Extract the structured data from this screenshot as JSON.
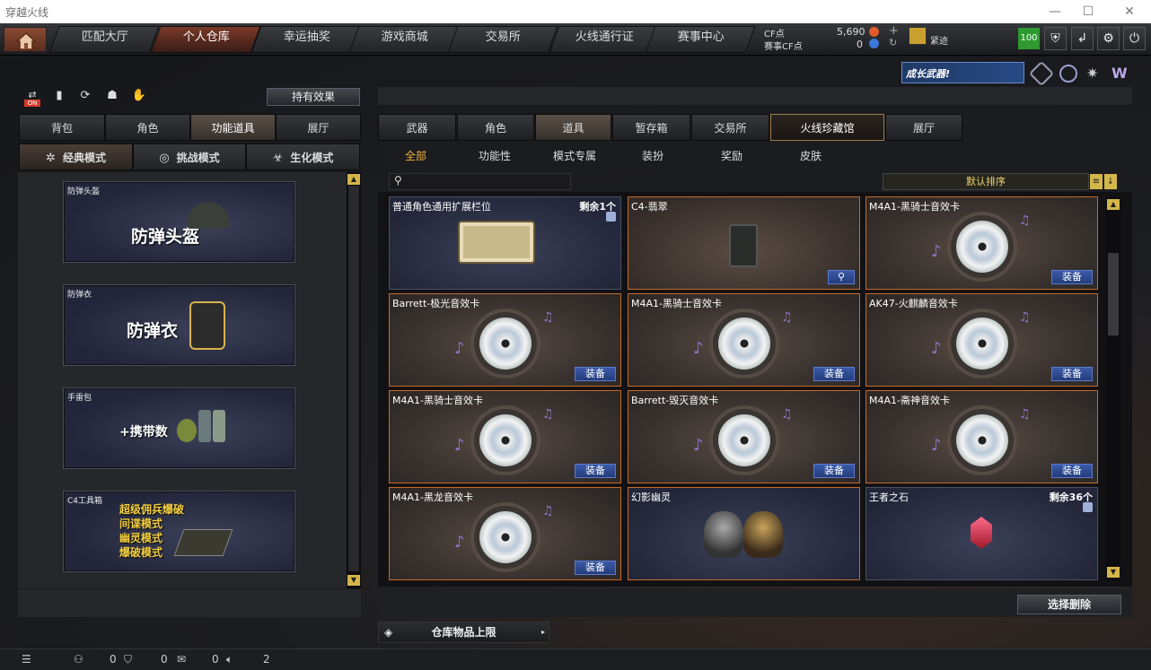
{
  "window": {
    "title": "穿越火线",
    "min": "—",
    "max": "☐",
    "close": "✕"
  },
  "nav": {
    "tabs": [
      "匹配大厅",
      "个人仓库",
      "幸运抽奖",
      "游戏商城",
      "交易所",
      "火线通行证",
      "赛事中心"
    ],
    "active_index": 1
  },
  "currency": {
    "cf_label": "CF点",
    "cf_value": "5,690",
    "match_label": "赛事CF点",
    "match_value": "0",
    "plus": "+",
    "refresh": "↻",
    "rank_name": "紧迹",
    "badge": "100",
    "brand_color": "#c66a2a"
  },
  "promo": {
    "banner": "成长武器!"
  },
  "left": {
    "on_label": "ON",
    "effect_button": "持有效果",
    "tabs": [
      "背包",
      "角色",
      "功能道具",
      "展厅"
    ],
    "active_tab": 2,
    "modes": [
      "经典模式",
      "挑战模式",
      "生化模式"
    ],
    "active_mode": 0,
    "cards": [
      {
        "caption": "防弹头盔",
        "big": "防弹头盔"
      },
      {
        "caption": "防弹衣",
        "big": "防弹衣"
      },
      {
        "caption": "手雷包",
        "big": "+携带数"
      },
      {
        "caption": "C4工具箱",
        "lines": [
          "超级佣兵爆破",
          "间谍模式",
          "幽灵模式",
          "爆破模式"
        ]
      }
    ]
  },
  "right": {
    "tabs": [
      "武器",
      "角色",
      "道具",
      "暂存箱",
      "交易所",
      "火线珍藏馆",
      "展厅"
    ],
    "active_tab": 5,
    "subtabs": [
      "全部",
      "功能性",
      "模式专属",
      "装扮",
      "奖励",
      "皮肤"
    ],
    "active_sub": 0,
    "search_placeholder": "",
    "sort_label": "默认排序",
    "equip_label": "装备",
    "items": [
      {
        "name": "普通角色通用扩展栏位",
        "remain": "剩余1个",
        "type": "key"
      },
      {
        "name": "C4-翡翠",
        "type": "c4"
      },
      {
        "name": "M4A1-黑骑士音效卡",
        "type": "music",
        "equip": true
      },
      {
        "name": "Barrett-极光音效卡",
        "type": "music",
        "equip": true
      },
      {
        "name": "M4A1-黑骑士音效卡",
        "type": "music",
        "equip": true
      },
      {
        "name": "AK47-火麒麟音效卡",
        "type": "music",
        "equip": true
      },
      {
        "name": "M4A1-黑骑士音效卡",
        "type": "music",
        "equip": true
      },
      {
        "name": "Barrett-毁灭音效卡",
        "type": "music",
        "equip": true
      },
      {
        "name": "M4A1-斋神音效卡",
        "type": "music",
        "equip": true
      },
      {
        "name": "M4A1-黑龙音效卡",
        "type": "music",
        "equip": true
      },
      {
        "name": "幻影幽灵",
        "type": "ghost"
      },
      {
        "name": "王者之石",
        "remain": "剩余36个",
        "type": "gem"
      }
    ],
    "delete_button": "选择删除",
    "limit_label": "仓库物品上限"
  },
  "bottom": {
    "counts": [
      "0",
      "0",
      "0",
      "2"
    ]
  }
}
